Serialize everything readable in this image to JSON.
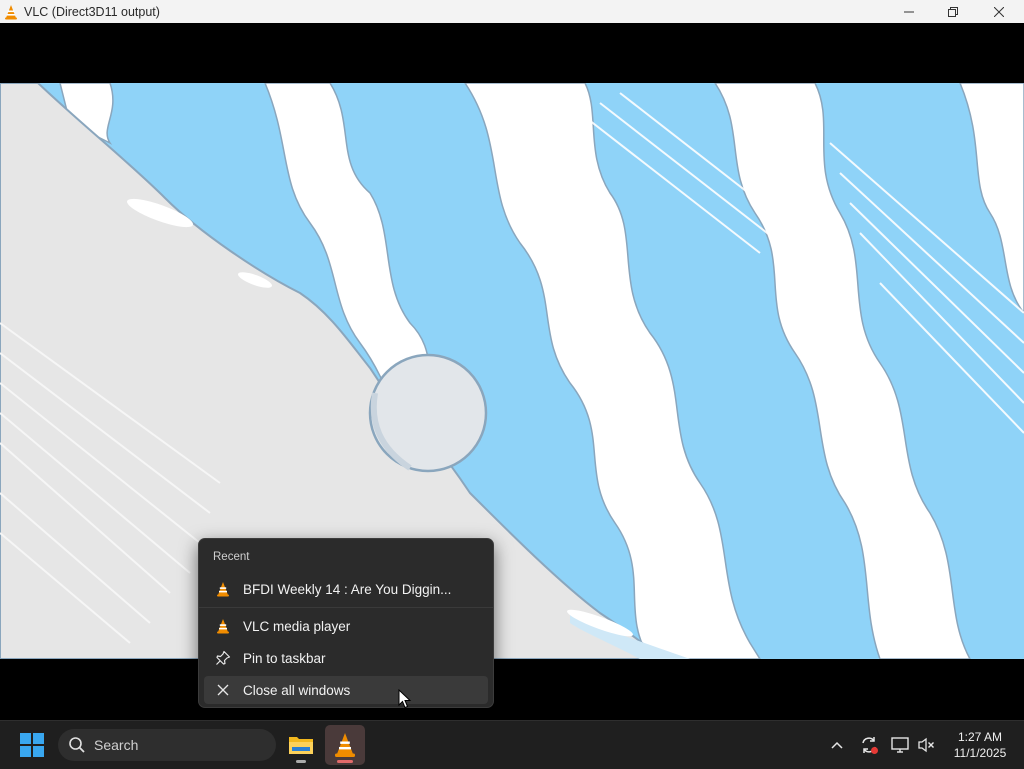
{
  "window": {
    "title": "VLC (Direct3D11 output)",
    "controls": {
      "minimize": "minimize",
      "maximize": "restore",
      "close": "close"
    }
  },
  "jumplist": {
    "header": "Recent",
    "recent_items": [
      {
        "label": "BFDI Weekly 14 : Are You Diggin...",
        "icon": "vlc-cone-icon"
      }
    ],
    "tasks": [
      {
        "label": "VLC media player",
        "icon": "vlc-cone-icon"
      },
      {
        "label": "Pin to taskbar",
        "icon": "pin-icon"
      },
      {
        "label": "Close all windows",
        "icon": "close-icon"
      }
    ]
  },
  "taskbar": {
    "search_placeholder": "Search",
    "apps": [
      {
        "name": "File Explorer",
        "icon": "folder-icon"
      },
      {
        "name": "VLC media player",
        "icon": "vlc-cone-icon"
      }
    ],
    "tray": {
      "icons": [
        "chevron-up-icon",
        "sync-alert-icon",
        "display-icon",
        "speaker-muted-icon"
      ]
    },
    "clock": {
      "time": "1:27 AM",
      "date": "11/1/2025"
    }
  },
  "colors": {
    "sky": "#8fd3f8",
    "cloud": "#ffffff",
    "ground": "#e6e6e6",
    "outline": "#8aa6bd",
    "vlc_orange": "#f08c00"
  }
}
